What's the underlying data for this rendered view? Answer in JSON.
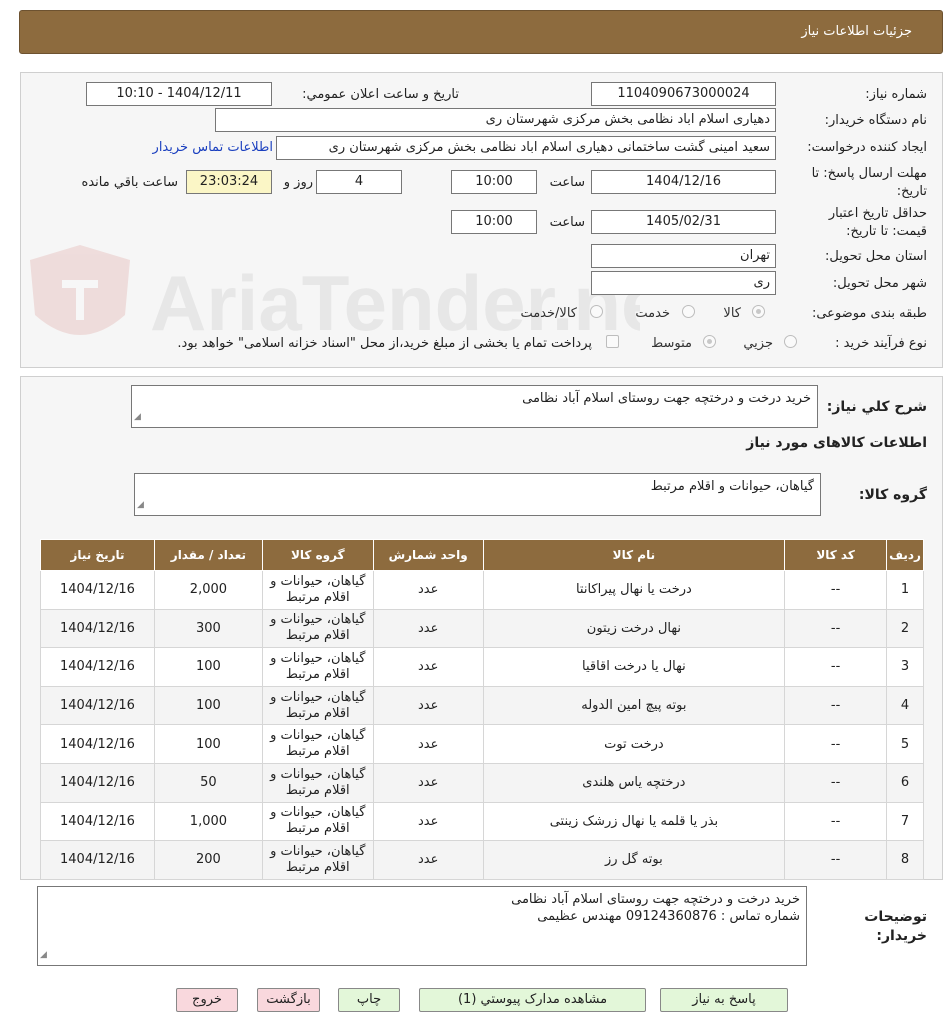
{
  "header": {
    "title": "جزئیات اطلاعات نیاز"
  },
  "watermark": {
    "text": "AriaTender.neT"
  },
  "info": {
    "need_no_label": "شماره نیاز:",
    "need_no": "1104090673000024",
    "announce_label": "تاریخ و ساعت اعلان عمومي:",
    "announce_value": "1404/12/11 - 10:10",
    "org_label": "نام دستگاه خریدار:",
    "org_value": "دهیاری اسلام اباد نظامی بخش مرکزی شهرستان ری",
    "creator_label": "ایجاد کننده درخواست:",
    "creator_value": "سعید امینی گشت ساختمانی دهیاری اسلام اباد نظامی بخش مرکزی شهرستان ری",
    "contact_link": "اطلاعات تماس خریدار",
    "deadline_label_1": "مهلت ارسال پاسخ: تا",
    "deadline_label_2": "تاریخ:",
    "deadline_date": "1404/12/16",
    "time_label": "ساعت",
    "deadline_time": "10:00",
    "days_value": "4",
    "days_label": "روز و",
    "remaining_time": "23:03:24",
    "remaining_label": "ساعت باقي مانده",
    "validity_label_1": "حداقل تاریخ اعتبار",
    "validity_label_2": "قیمت: تا تاریخ:",
    "validity_date": "1405/02/31",
    "validity_time_label": "ساعت",
    "validity_time": "10:00",
    "province_label": "استان محل تحویل:",
    "province_value": "تهران",
    "city_label": "شهر محل تحویل:",
    "city_value": "ری",
    "category_label": "طبقه بندی موضوعی:",
    "category_options": [
      "کالا",
      "خدمت",
      "کالا/خدمت"
    ],
    "process_label": "نوع فرآیند خرید :",
    "process_options": [
      "جزیي",
      "متوسط"
    ],
    "payment_note": "پرداخت تمام یا بخشی از مبلغ خرید،از محل \"اسناد خزانه اسلامی\" خواهد بود."
  },
  "summary": {
    "label": "شرح کلي نیاز:",
    "value": "خرید درخت و درختچه جهت روستای اسلام آباد نظامی",
    "items_title": "اطلاعات کالاهای مورد نیاز",
    "group_label": "گروه کالا:",
    "group_value": "گیاهان، حیوانات و اقلام مرتبط"
  },
  "table": {
    "headers": [
      "ردیف",
      "کد کالا",
      "نام کالا",
      "واحد شمارش",
      "گروه کالا",
      "تعداد / مقدار",
      "تاریخ نیاز"
    ],
    "rows": [
      {
        "idx": "1",
        "code": "--",
        "name": "درخت یا نهال پیراکانتا",
        "unit": "عدد",
        "group1": "گیاهان، حیوانات و",
        "group2": "اقلام مرتبط",
        "qty": "2,000",
        "date": "1404/12/16"
      },
      {
        "idx": "2",
        "code": "--",
        "name": "نهال درخت زیتون",
        "unit": "عدد",
        "group1": "گیاهان، حیوانات و",
        "group2": "اقلام مرتبط",
        "qty": "300",
        "date": "1404/12/16"
      },
      {
        "idx": "3",
        "code": "--",
        "name": "نهال یا درخت اقاقیا",
        "unit": "عدد",
        "group1": "گیاهان، حیوانات و",
        "group2": "اقلام مرتبط",
        "qty": "100",
        "date": "1404/12/16"
      },
      {
        "idx": "4",
        "code": "--",
        "name": "بوته پیچ امین الدوله",
        "unit": "عدد",
        "group1": "گیاهان، حیوانات و",
        "group2": "اقلام مرتبط",
        "qty": "100",
        "date": "1404/12/16"
      },
      {
        "idx": "5",
        "code": "--",
        "name": "درخت توت",
        "unit": "عدد",
        "group1": "گیاهان، حیوانات و",
        "group2": "اقلام مرتبط",
        "qty": "100",
        "date": "1404/12/16"
      },
      {
        "idx": "6",
        "code": "--",
        "name": "درختچه یاس هلندی",
        "unit": "عدد",
        "group1": "گیاهان، حیوانات و",
        "group2": "اقلام مرتبط",
        "qty": "50",
        "date": "1404/12/16"
      },
      {
        "idx": "7",
        "code": "--",
        "name": "بذر یا قلمه یا نهال زرشک زینتی",
        "unit": "عدد",
        "group1": "گیاهان، حیوانات و",
        "group2": "اقلام مرتبط",
        "qty": "1,000",
        "date": "1404/12/16"
      },
      {
        "idx": "8",
        "code": "--",
        "name": "بوته گل رز",
        "unit": "عدد",
        "group1": "گیاهان، حیوانات و",
        "group2": "اقلام مرتبط",
        "qty": "200",
        "date": "1404/12/16"
      }
    ]
  },
  "notes": {
    "label_1": "توضیحات",
    "label_2": "خریدار:",
    "line1": "خرید درخت و درختچه جهت روستای اسلام آباد نظامی",
    "line2": "شماره تماس : 09124360876 مهندس عظیمی"
  },
  "buttons": {
    "reply": "پاسخ به نیاز",
    "attachments": "مشاهده مدارک پیوستي (1)",
    "print": "چاپ",
    "back": "بازگشت",
    "exit": "خروج"
  },
  "colors": {
    "brand": "#8d6b3e",
    "link": "#1a3fbf",
    "highlight": "#fbf6c6",
    "green_button": "#e3f7d9",
    "pink_button": "#f9d8dd"
  }
}
